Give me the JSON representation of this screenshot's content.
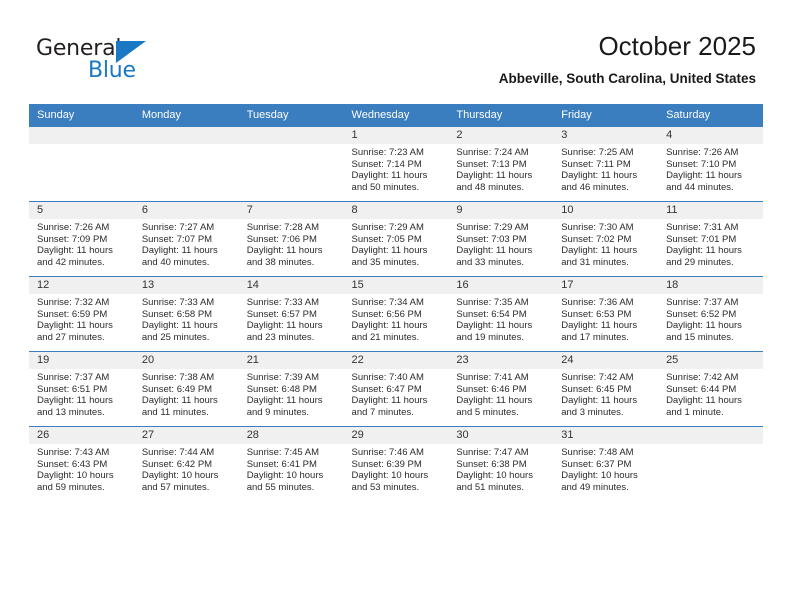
{
  "brand": {
    "name_part1": "General",
    "name_part2": "Blue",
    "accent_color": "#1b79c3"
  },
  "header": {
    "title": "October 2025",
    "subtitle": "Abbeville, South Carolina, United States"
  },
  "calendar": {
    "header_bg": "#3a7ebf",
    "date_band_bg": "#f0f0f0",
    "weekdays": [
      "Sunday",
      "Monday",
      "Tuesday",
      "Wednesday",
      "Thursday",
      "Friday",
      "Saturday"
    ],
    "weeks": [
      [
        {
          "day": "",
          "sunrise": "",
          "sunset": "",
          "daylight": ""
        },
        {
          "day": "",
          "sunrise": "",
          "sunset": "",
          "daylight": ""
        },
        {
          "day": "",
          "sunrise": "",
          "sunset": "",
          "daylight": ""
        },
        {
          "day": "1",
          "sunrise": "Sunrise: 7:23 AM",
          "sunset": "Sunset: 7:14 PM",
          "daylight": "Daylight: 11 hours and 50 minutes."
        },
        {
          "day": "2",
          "sunrise": "Sunrise: 7:24 AM",
          "sunset": "Sunset: 7:13 PM",
          "daylight": "Daylight: 11 hours and 48 minutes."
        },
        {
          "day": "3",
          "sunrise": "Sunrise: 7:25 AM",
          "sunset": "Sunset: 7:11 PM",
          "daylight": "Daylight: 11 hours and 46 minutes."
        },
        {
          "day": "4",
          "sunrise": "Sunrise: 7:26 AM",
          "sunset": "Sunset: 7:10 PM",
          "daylight": "Daylight: 11 hours and 44 minutes."
        }
      ],
      [
        {
          "day": "5",
          "sunrise": "Sunrise: 7:26 AM",
          "sunset": "Sunset: 7:09 PM",
          "daylight": "Daylight: 11 hours and 42 minutes."
        },
        {
          "day": "6",
          "sunrise": "Sunrise: 7:27 AM",
          "sunset": "Sunset: 7:07 PM",
          "daylight": "Daylight: 11 hours and 40 minutes."
        },
        {
          "day": "7",
          "sunrise": "Sunrise: 7:28 AM",
          "sunset": "Sunset: 7:06 PM",
          "daylight": "Daylight: 11 hours and 38 minutes."
        },
        {
          "day": "8",
          "sunrise": "Sunrise: 7:29 AM",
          "sunset": "Sunset: 7:05 PM",
          "daylight": "Daylight: 11 hours and 35 minutes."
        },
        {
          "day": "9",
          "sunrise": "Sunrise: 7:29 AM",
          "sunset": "Sunset: 7:03 PM",
          "daylight": "Daylight: 11 hours and 33 minutes."
        },
        {
          "day": "10",
          "sunrise": "Sunrise: 7:30 AM",
          "sunset": "Sunset: 7:02 PM",
          "daylight": "Daylight: 11 hours and 31 minutes."
        },
        {
          "day": "11",
          "sunrise": "Sunrise: 7:31 AM",
          "sunset": "Sunset: 7:01 PM",
          "daylight": "Daylight: 11 hours and 29 minutes."
        }
      ],
      [
        {
          "day": "12",
          "sunrise": "Sunrise: 7:32 AM",
          "sunset": "Sunset: 6:59 PM",
          "daylight": "Daylight: 11 hours and 27 minutes."
        },
        {
          "day": "13",
          "sunrise": "Sunrise: 7:33 AM",
          "sunset": "Sunset: 6:58 PM",
          "daylight": "Daylight: 11 hours and 25 minutes."
        },
        {
          "day": "14",
          "sunrise": "Sunrise: 7:33 AM",
          "sunset": "Sunset: 6:57 PM",
          "daylight": "Daylight: 11 hours and 23 minutes."
        },
        {
          "day": "15",
          "sunrise": "Sunrise: 7:34 AM",
          "sunset": "Sunset: 6:56 PM",
          "daylight": "Daylight: 11 hours and 21 minutes."
        },
        {
          "day": "16",
          "sunrise": "Sunrise: 7:35 AM",
          "sunset": "Sunset: 6:54 PM",
          "daylight": "Daylight: 11 hours and 19 minutes."
        },
        {
          "day": "17",
          "sunrise": "Sunrise: 7:36 AM",
          "sunset": "Sunset: 6:53 PM",
          "daylight": "Daylight: 11 hours and 17 minutes."
        },
        {
          "day": "18",
          "sunrise": "Sunrise: 7:37 AM",
          "sunset": "Sunset: 6:52 PM",
          "daylight": "Daylight: 11 hours and 15 minutes."
        }
      ],
      [
        {
          "day": "19",
          "sunrise": "Sunrise: 7:37 AM",
          "sunset": "Sunset: 6:51 PM",
          "daylight": "Daylight: 11 hours and 13 minutes."
        },
        {
          "day": "20",
          "sunrise": "Sunrise: 7:38 AM",
          "sunset": "Sunset: 6:49 PM",
          "daylight": "Daylight: 11 hours and 11 minutes."
        },
        {
          "day": "21",
          "sunrise": "Sunrise: 7:39 AM",
          "sunset": "Sunset: 6:48 PM",
          "daylight": "Daylight: 11 hours and 9 minutes."
        },
        {
          "day": "22",
          "sunrise": "Sunrise: 7:40 AM",
          "sunset": "Sunset: 6:47 PM",
          "daylight": "Daylight: 11 hours and 7 minutes."
        },
        {
          "day": "23",
          "sunrise": "Sunrise: 7:41 AM",
          "sunset": "Sunset: 6:46 PM",
          "daylight": "Daylight: 11 hours and 5 minutes."
        },
        {
          "day": "24",
          "sunrise": "Sunrise: 7:42 AM",
          "sunset": "Sunset: 6:45 PM",
          "daylight": "Daylight: 11 hours and 3 minutes."
        },
        {
          "day": "25",
          "sunrise": "Sunrise: 7:42 AM",
          "sunset": "Sunset: 6:44 PM",
          "daylight": "Daylight: 11 hours and 1 minute."
        }
      ],
      [
        {
          "day": "26",
          "sunrise": "Sunrise: 7:43 AM",
          "sunset": "Sunset: 6:43 PM",
          "daylight": "Daylight: 10 hours and 59 minutes."
        },
        {
          "day": "27",
          "sunrise": "Sunrise: 7:44 AM",
          "sunset": "Sunset: 6:42 PM",
          "daylight": "Daylight: 10 hours and 57 minutes."
        },
        {
          "day": "28",
          "sunrise": "Sunrise: 7:45 AM",
          "sunset": "Sunset: 6:41 PM",
          "daylight": "Daylight: 10 hours and 55 minutes."
        },
        {
          "day": "29",
          "sunrise": "Sunrise: 7:46 AM",
          "sunset": "Sunset: 6:39 PM",
          "daylight": "Daylight: 10 hours and 53 minutes."
        },
        {
          "day": "30",
          "sunrise": "Sunrise: 7:47 AM",
          "sunset": "Sunset: 6:38 PM",
          "daylight": "Daylight: 10 hours and 51 minutes."
        },
        {
          "day": "31",
          "sunrise": "Sunrise: 7:48 AM",
          "sunset": "Sunset: 6:37 PM",
          "daylight": "Daylight: 10 hours and 49 minutes."
        },
        {
          "day": "",
          "sunrise": "",
          "sunset": "",
          "daylight": ""
        }
      ]
    ]
  }
}
